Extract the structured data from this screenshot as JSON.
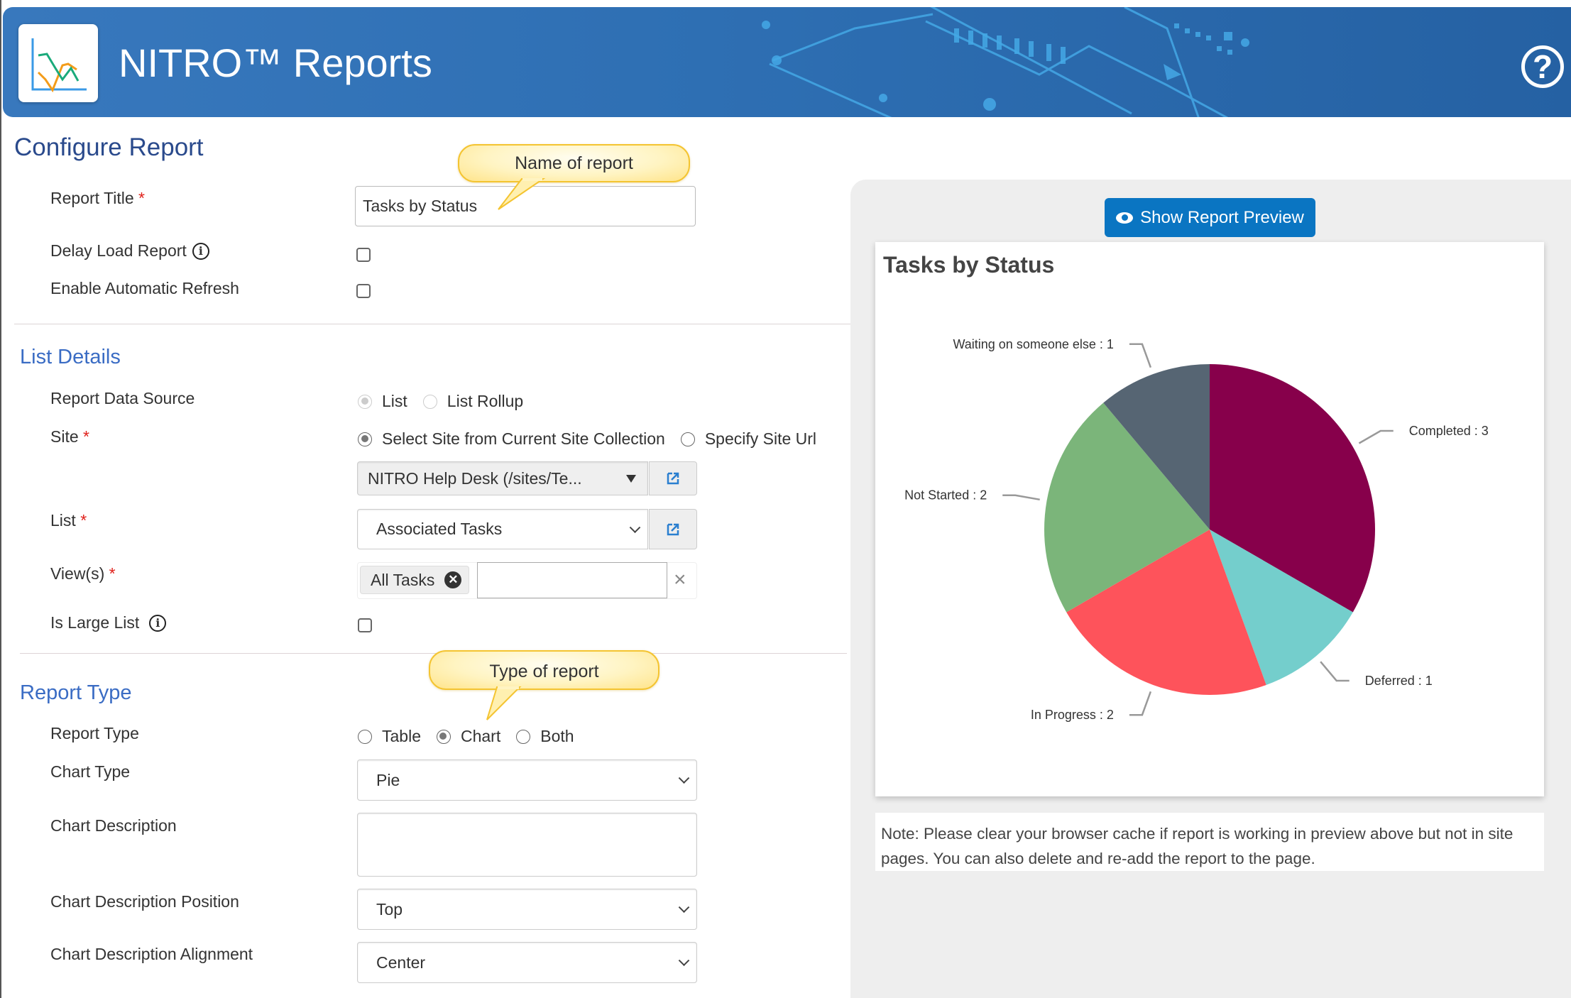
{
  "header": {
    "app_title": "NITRO™ Reports",
    "logo_icon": "line-chart-icon",
    "help_icon": "question-circle-icon",
    "help_glyph": "?"
  },
  "page_title": "Configure Report",
  "callouts": {
    "name_of_report": "Name of report",
    "type_of_report": "Type of report"
  },
  "general": {
    "report_title_label": "Report Title",
    "report_title_value": "Tasks by Status",
    "delay_load_label": "Delay Load Report",
    "delay_load_checked": false,
    "auto_refresh_label": "Enable Automatic Refresh",
    "auto_refresh_checked": false,
    "required_mark": "*",
    "info_glyph": "i"
  },
  "list_details": {
    "section_title": "List Details",
    "data_source_label": "Report Data Source",
    "data_source_options": [
      {
        "label": "List",
        "selected": true,
        "disabled": true
      },
      {
        "label": "List Rollup",
        "selected": false,
        "disabled": true
      }
    ],
    "site_label": "Site",
    "site_options": [
      {
        "label": "Select Site from Current Site Collection",
        "selected": true
      },
      {
        "label": "Specify Site Url",
        "selected": false
      }
    ],
    "site_value": "NITRO Help Desk (/sites/Te...",
    "list_label": "List",
    "list_value": "Associated Tasks",
    "views_label": "View(s)",
    "views_selected": [
      "All Tasks"
    ],
    "views_input_value": "",
    "clear_glyph": "×",
    "is_large_list_label": "Is Large List",
    "is_large_list_checked": false
  },
  "report_type": {
    "section_title": "Report Type",
    "report_type_label": "Report Type",
    "report_type_options": [
      {
        "label": "Table",
        "selected": false
      },
      {
        "label": "Chart",
        "selected": true
      },
      {
        "label": "Both",
        "selected": false
      }
    ],
    "chart_type_label": "Chart Type",
    "chart_type_value": "Pie",
    "chart_description_label": "Chart Description",
    "chart_description_value": "",
    "chart_description_position_label": "Chart Description Position",
    "chart_description_position_value": "Top",
    "chart_description_alignment_label": "Chart Description Alignment",
    "chart_description_alignment_value": "Center"
  },
  "preview": {
    "button_label": "Show Report Preview",
    "button_icon": "eye-icon",
    "note": "Note: Please clear your browser cache if report is working in preview above but not in site pages. You can also delete and re-add the report to the page."
  },
  "chart_data": {
    "type": "pie",
    "title": "Tasks by Status",
    "categories": [
      "Completed",
      "Deferred",
      "In Progress",
      "Not Started",
      "Waiting on someone else"
    ],
    "values": [
      3,
      1,
      2,
      2,
      1
    ],
    "colors": [
      "#87004b",
      "#74cecc",
      "#fe535b",
      "#7bb57a",
      "#566573"
    ],
    "label_format": "{category} : {value}",
    "start": "top, clockwise",
    "legend": "none (outside labels with leader lines)"
  }
}
